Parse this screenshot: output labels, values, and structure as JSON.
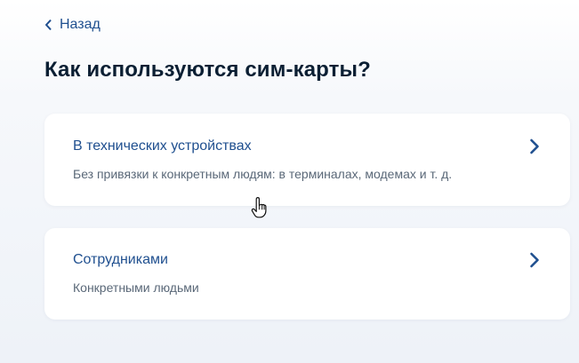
{
  "nav": {
    "back_label": "Назад"
  },
  "page": {
    "title": "Как используются сим-карты?"
  },
  "options": [
    {
      "title": "В технических устройствах",
      "description": "Без привязки к конкретным людям: в терминалах, модемах и т. д."
    },
    {
      "title": "Сотрудниками",
      "description": "Конкретными людьми"
    }
  ],
  "colors": {
    "accent": "#1f4f8f",
    "title": "#0b1f33",
    "muted": "#5a6878",
    "card_bg": "#ffffff",
    "page_bg": "#f4f6fa"
  },
  "icons": {
    "back": "chevron-left-icon",
    "option": "chevron-right-icon",
    "cursor": "hand-pointer-icon"
  }
}
